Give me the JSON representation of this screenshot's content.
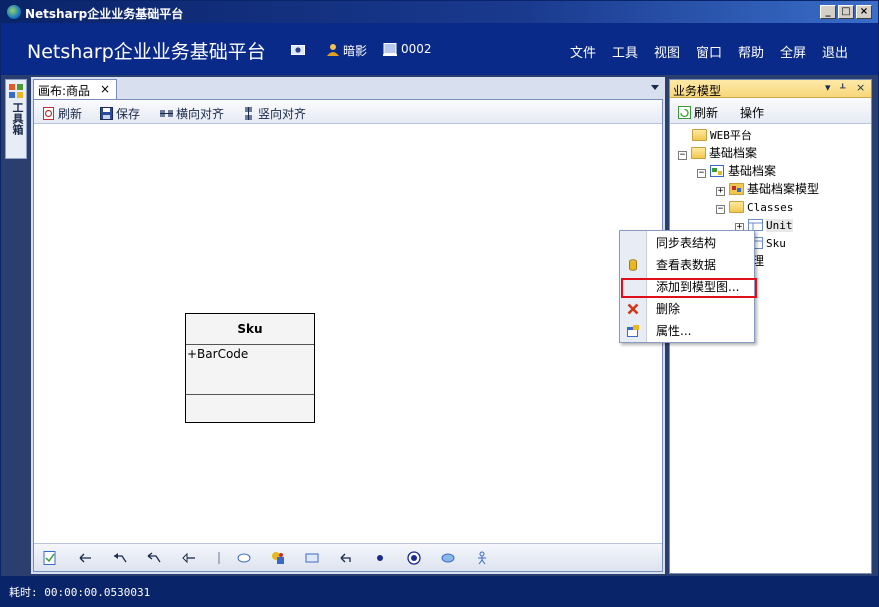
{
  "window": {
    "title": "Netsharp企业业务基础平台",
    "controls": {
      "minimize": "_",
      "maximize": "□",
      "close": "×"
    }
  },
  "header": {
    "brand": "Netsharp企业业务基础平台",
    "user": "暗影",
    "org": "0002",
    "menu": [
      "文件",
      "工具",
      "视图",
      "窗口",
      "帮助",
      "全屏",
      "退出"
    ]
  },
  "toolbox": {
    "label": "工具箱"
  },
  "document": {
    "tab_label": "画布:商品",
    "tab_close": "×",
    "toolbar": {
      "refresh": "刷新",
      "save": "保存",
      "align_horizontal": "横向对齐",
      "align_vertical": "竖向对齐"
    },
    "class_box": {
      "name": "Sku",
      "attributes": [
        "+BarCode"
      ]
    },
    "bottom_tools": [
      "check-icon",
      "arrow-left-icon",
      "association-icon",
      "dependency-icon",
      "inheritance-icon",
      "separator",
      "ellipse-icon",
      "component-icon",
      "rectangle-icon",
      "back-arrow-icon",
      "dot-icon",
      "target-icon",
      "oval-icon",
      "actor-icon"
    ]
  },
  "right_panel": {
    "title": "业务模型",
    "pin": "ᚆ",
    "close": "×",
    "toolbar": {
      "refresh": "刷新",
      "actions": "操作"
    },
    "tree": [
      {
        "label": "WEB平台",
        "level": 1,
        "expander": "",
        "mono": true
      },
      {
        "label": "基础档案",
        "level": 1,
        "expander": "−"
      },
      {
        "label": "基础档案",
        "level": 2,
        "expander": "−"
      },
      {
        "label": "基础档案模型",
        "level": 3,
        "expander": "+"
      },
      {
        "label": "Classes",
        "level": 3,
        "expander": "−",
        "mono": true
      },
      {
        "label": "Unit",
        "level": 4,
        "expander": "+",
        "mono": true,
        "selected": true
      },
      {
        "label": "Sku",
        "level": 4,
        "expander": "",
        "mono": true
      },
      {
        "label": "理",
        "level": 4,
        "expander": ""
      }
    ]
  },
  "context_menu": {
    "items": [
      {
        "label": "同步表结构",
        "icon": ""
      },
      {
        "label": "查看表数据",
        "icon": "database-icon"
      },
      {
        "label": "添加到模型图...",
        "icon": ""
      },
      {
        "label": "删除",
        "icon": "delete-icon"
      },
      {
        "label": "属性...",
        "icon": "properties-icon"
      }
    ],
    "highlight_color": "#e0101a"
  },
  "status": {
    "text": "耗时: 00:00:00.0530031"
  },
  "colors": {
    "accent": "#0a246a",
    "header": "#0a2a8a",
    "panel_header": "#f8d77a"
  }
}
